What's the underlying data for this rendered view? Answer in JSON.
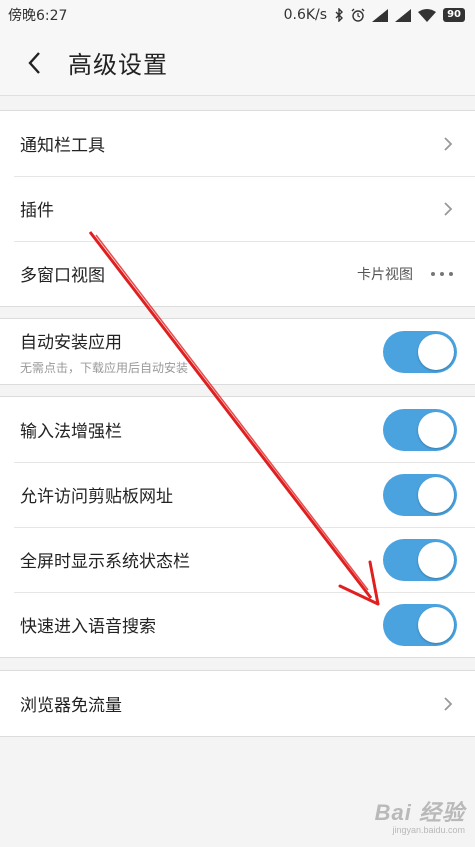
{
  "status_bar": {
    "time": "傍晚6:27",
    "speed": "0.6K/s",
    "battery": "90"
  },
  "header": {
    "title": "高级设置"
  },
  "group1": {
    "items": [
      {
        "label": "通知栏工具"
      },
      {
        "label": "插件"
      },
      {
        "label": "多窗口视图",
        "value": "卡片视图"
      }
    ]
  },
  "group2": {
    "items": [
      {
        "label": "自动安装应用",
        "sublabel": "无需点击，下载应用后自动安装",
        "enabled": true
      }
    ]
  },
  "group3": {
    "items": [
      {
        "label": "输入法增强栏",
        "enabled": true
      },
      {
        "label": "允许访问剪贴板网址",
        "enabled": true
      },
      {
        "label": "全屏时显示系统状态栏",
        "enabled": true
      },
      {
        "label": "快速进入语音搜索",
        "enabled": true
      }
    ]
  },
  "group4": {
    "items": [
      {
        "label": "浏览器免流量"
      }
    ]
  },
  "colors": {
    "toggle_on": "#4aa3df",
    "annotation": "#e02020"
  },
  "icons": [
    "back-icon",
    "chevron-right-icon",
    "more-icon",
    "bluetooth-icon",
    "alarm-icon",
    "signal-icon",
    "wifi-icon",
    "battery-icon"
  ],
  "watermark": {
    "main": "Bai 经验",
    "sub": "jingyan.baidu.com"
  }
}
